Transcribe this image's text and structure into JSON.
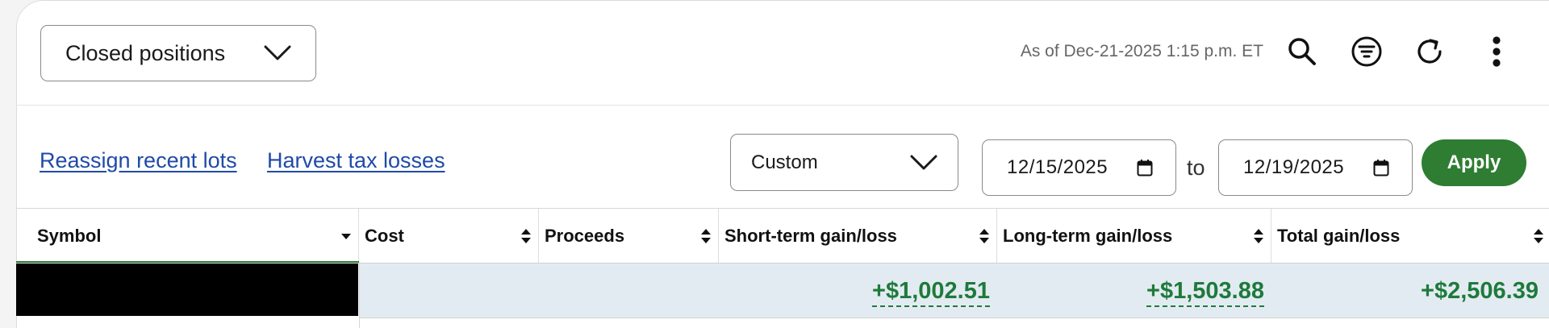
{
  "header": {
    "view_select": "Closed positions",
    "as_of": "As of Dec-21-2025 1:15 p.m. ET",
    "icons": [
      "search-icon",
      "filter-icon",
      "refresh-icon",
      "more-vertical-icon"
    ]
  },
  "toolbar": {
    "links": {
      "reassign": "Reassign recent lots",
      "harvest": "Harvest tax losses"
    },
    "range_select": "Custom",
    "from_date": "12/15/2025",
    "to_label": "to",
    "to_date": "12/19/2025",
    "apply": "Apply"
  },
  "table": {
    "columns": [
      "Symbol",
      "Cost",
      "Proceeds",
      "Short-term gain/loss",
      "Long-term gain/loss",
      "Total gain/loss"
    ],
    "summary_row": {
      "short_term": "+$1,002.51",
      "long_term": "+$1,503.88",
      "total": "+$2,506.39"
    }
  },
  "colors": {
    "accent_green": "#2e7d32",
    "gain_green": "#1e7a3b",
    "link_blue": "#1f4aa8",
    "row_highlight": "#e3ebf2"
  }
}
